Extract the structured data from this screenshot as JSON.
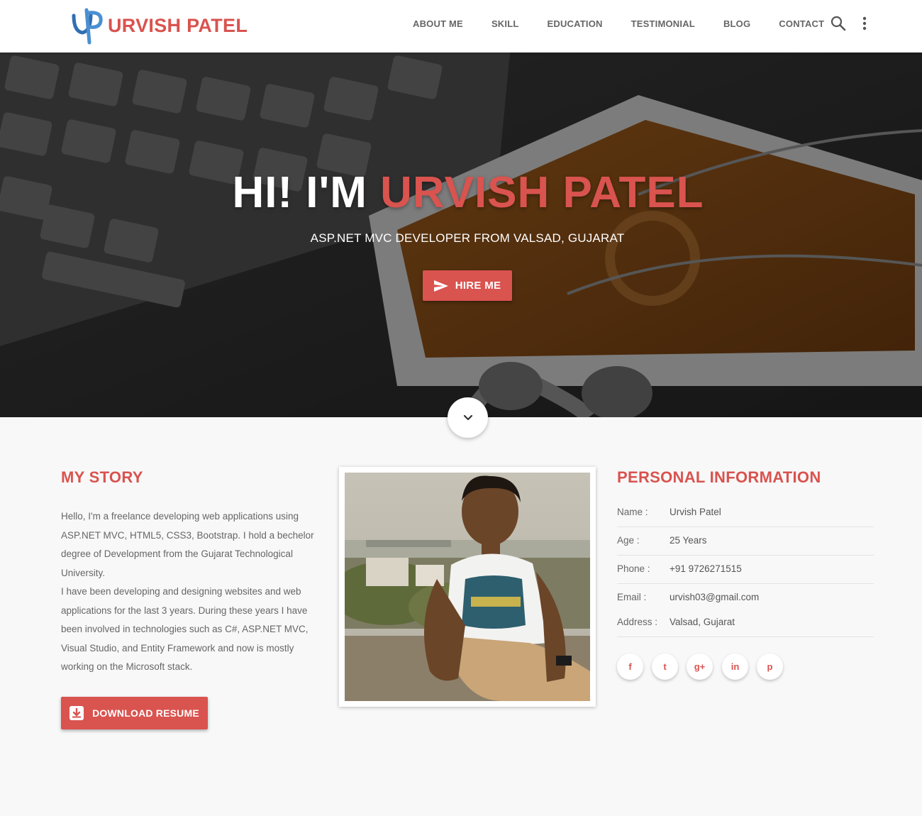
{
  "brand": {
    "name": "URVISH PATEL",
    "accent_color": "#d9534f"
  },
  "nav": {
    "items": [
      "ABOUT ME",
      "SKILL",
      "EDUCATION",
      "TESTIMONIAL",
      "BLOG",
      "CONTACT"
    ],
    "search_icon": "search-icon",
    "more_icon": "more-vertical-icon"
  },
  "hero": {
    "greeting": "HI! I'M ",
    "name": "URVISH PATEL",
    "subtitle": "ASP.NET MVC DEVELOPER FROM VALSAD, GUJARAT",
    "hire_button": "HIRE ME",
    "scroll_icon": "chevron-down-icon"
  },
  "story": {
    "title": "MY STORY",
    "paragraph1": "Hello, I'm a freelance developing web applications using ASP.NET MVC, HTML5, CSS3, Bootstrap. I hold a bechelor degree of Development from the Gujarat Technological University.",
    "paragraph2": "I have been developing and designing websites and web applications for the last 3 years. During these years I have been involved in technologies such as C#, ASP.NET MVC, Visual Studio, and Entity Framework and now is mostly working on the Microsoft stack.",
    "download_button": "DOWNLOAD RESUME"
  },
  "personal": {
    "title": "PERSONAL INFORMATION",
    "rows": [
      {
        "label": "Name :",
        "value": "Urvish Patel"
      },
      {
        "label": "Age :",
        "value": "25 Years"
      },
      {
        "label": "Phone :",
        "value": "+91 9726271515"
      },
      {
        "label": "Email :",
        "value": "urvish03@gmail.com"
      },
      {
        "label": "Address :",
        "value": "Valsad, Gujarat"
      }
    ],
    "social": [
      {
        "icon": "facebook-icon",
        "glyph": "f"
      },
      {
        "icon": "twitter-icon",
        "glyph": "t"
      },
      {
        "icon": "google-plus-icon",
        "glyph": "g+"
      },
      {
        "icon": "linkedin-icon",
        "glyph": "in"
      },
      {
        "icon": "pinterest-icon",
        "glyph": "p"
      }
    ]
  }
}
